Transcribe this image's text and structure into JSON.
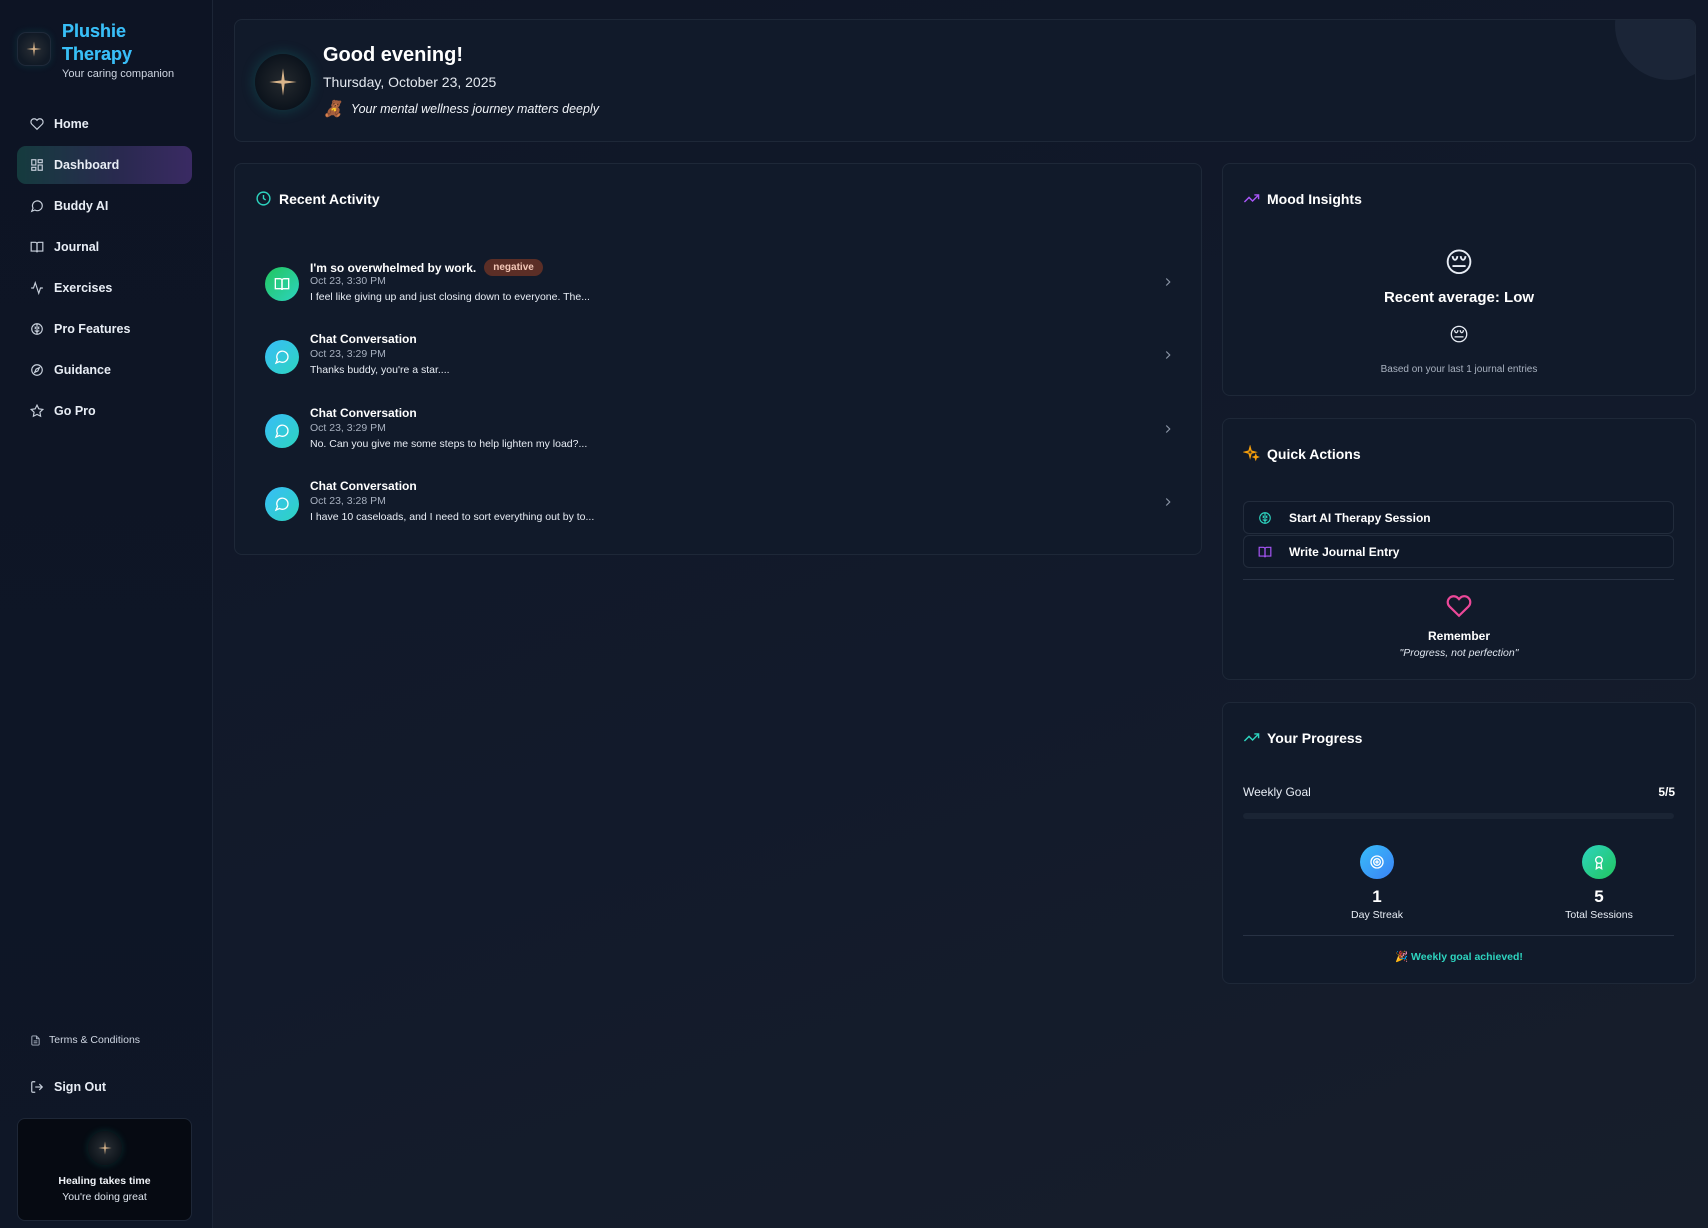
{
  "brand": {
    "name_line1": "Plushie",
    "name_line2": "Therapy",
    "tagline": "Your caring companion"
  },
  "nav": [
    {
      "label": "Home",
      "icon": "heart-icon"
    },
    {
      "label": "Dashboard",
      "icon": "dashboard-icon",
      "active": true
    },
    {
      "label": "Buddy AI",
      "icon": "chat-icon"
    },
    {
      "label": "Journal",
      "icon": "book-icon"
    },
    {
      "label": "Exercises",
      "icon": "activity-icon"
    },
    {
      "label": "Pro Features",
      "icon": "brain-icon"
    },
    {
      "label": "Guidance",
      "icon": "compass-icon"
    },
    {
      "label": "Go Pro",
      "icon": "star-icon"
    }
  ],
  "footer_links": {
    "terms": "Terms & Conditions",
    "signout": "Sign Out"
  },
  "heal_card": {
    "title": "Healing takes time",
    "subtitle": "You're doing great"
  },
  "header": {
    "greeting": "Good evening!",
    "date": "Thursday, October 23, 2025",
    "motto": "Your mental wellness journey matters deeply",
    "motto_emoji": "🧸"
  },
  "recent_activity": {
    "title": "Recent Activity",
    "items": [
      {
        "type": "journal",
        "title": "I'm so overwhelmed by work.",
        "badge": "negative",
        "time": "Oct 23, 3:30 PM",
        "text": "I feel like giving up and just closing down to everyone. The..."
      },
      {
        "type": "chat",
        "title": "Chat Conversation",
        "time": "Oct 23, 3:29 PM",
        "text": "Thanks buddy, you're a star...."
      },
      {
        "type": "chat",
        "title": "Chat Conversation",
        "time": "Oct 23, 3:29 PM",
        "text": "No. Can you give me some steps to help lighten my load?..."
      },
      {
        "type": "chat",
        "title": "Chat Conversation",
        "time": "Oct 23, 3:28 PM",
        "text": "I have 10 caseloads, and I need to sort everything out by to..."
      }
    ]
  },
  "mood": {
    "title": "Mood Insights",
    "emoji": "😔",
    "average": "Recent average: Low",
    "small_emoji": "😔",
    "note": "Based on your last 1 journal entries"
  },
  "quick_actions": {
    "title": "Quick Actions",
    "buttons": [
      {
        "label": "Start AI Therapy Session",
        "icon": "brain-icon"
      },
      {
        "label": "Write Journal Entry",
        "icon": "book-icon"
      }
    ],
    "remember_title": "Remember",
    "remember_quote": "\"Progress, not perfection\""
  },
  "progress": {
    "title": "Your Progress",
    "goal_label": "Weekly Goal",
    "goal_value": "5/5",
    "goal_fraction": 1.0,
    "streak_value": "1",
    "streak_label": "Day Streak",
    "sessions_value": "5",
    "sessions_label": "Total Sessions",
    "achieved": "🎉 Weekly goal achieved!"
  },
  "colors": {
    "accent_teal": "#2dd4bf",
    "accent_purple": "#a855f7",
    "journal_green": "#22c55e",
    "chat_blue": "#38bdf8",
    "heart_pink": "#ec4899",
    "badge_negative": "#5b2e26"
  }
}
